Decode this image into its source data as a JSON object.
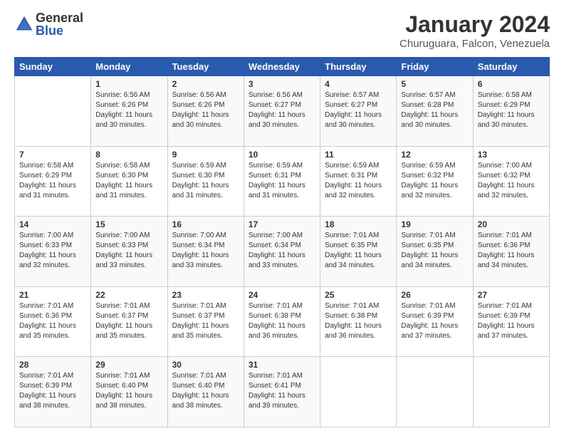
{
  "logo": {
    "general": "General",
    "blue": "Blue"
  },
  "title": "January 2024",
  "subtitle": "Churuguara, Falcon, Venezuela",
  "header_days": [
    "Sunday",
    "Monday",
    "Tuesday",
    "Wednesday",
    "Thursday",
    "Friday",
    "Saturday"
  ],
  "weeks": [
    [
      {
        "day": "",
        "sunrise": "",
        "sunset": "",
        "daylight": ""
      },
      {
        "day": "1",
        "sunrise": "Sunrise: 6:56 AM",
        "sunset": "Sunset: 6:26 PM",
        "daylight": "Daylight: 11 hours and 30 minutes."
      },
      {
        "day": "2",
        "sunrise": "Sunrise: 6:56 AM",
        "sunset": "Sunset: 6:26 PM",
        "daylight": "Daylight: 11 hours and 30 minutes."
      },
      {
        "day": "3",
        "sunrise": "Sunrise: 6:56 AM",
        "sunset": "Sunset: 6:27 PM",
        "daylight": "Daylight: 11 hours and 30 minutes."
      },
      {
        "day": "4",
        "sunrise": "Sunrise: 6:57 AM",
        "sunset": "Sunset: 6:27 PM",
        "daylight": "Daylight: 11 hours and 30 minutes."
      },
      {
        "day": "5",
        "sunrise": "Sunrise: 6:57 AM",
        "sunset": "Sunset: 6:28 PM",
        "daylight": "Daylight: 11 hours and 30 minutes."
      },
      {
        "day": "6",
        "sunrise": "Sunrise: 6:58 AM",
        "sunset": "Sunset: 6:29 PM",
        "daylight": "Daylight: 11 hours and 30 minutes."
      }
    ],
    [
      {
        "day": "7",
        "sunrise": "Sunrise: 6:58 AM",
        "sunset": "Sunset: 6:29 PM",
        "daylight": "Daylight: 11 hours and 31 minutes."
      },
      {
        "day": "8",
        "sunrise": "Sunrise: 6:58 AM",
        "sunset": "Sunset: 6:30 PM",
        "daylight": "Daylight: 11 hours and 31 minutes."
      },
      {
        "day": "9",
        "sunrise": "Sunrise: 6:59 AM",
        "sunset": "Sunset: 6:30 PM",
        "daylight": "Daylight: 11 hours and 31 minutes."
      },
      {
        "day": "10",
        "sunrise": "Sunrise: 6:59 AM",
        "sunset": "Sunset: 6:31 PM",
        "daylight": "Daylight: 11 hours and 31 minutes."
      },
      {
        "day": "11",
        "sunrise": "Sunrise: 6:59 AM",
        "sunset": "Sunset: 6:31 PM",
        "daylight": "Daylight: 11 hours and 32 minutes."
      },
      {
        "day": "12",
        "sunrise": "Sunrise: 6:59 AM",
        "sunset": "Sunset: 6:32 PM",
        "daylight": "Daylight: 11 hours and 32 minutes."
      },
      {
        "day": "13",
        "sunrise": "Sunrise: 7:00 AM",
        "sunset": "Sunset: 6:32 PM",
        "daylight": "Daylight: 11 hours and 32 minutes."
      }
    ],
    [
      {
        "day": "14",
        "sunrise": "Sunrise: 7:00 AM",
        "sunset": "Sunset: 6:33 PM",
        "daylight": "Daylight: 11 hours and 32 minutes."
      },
      {
        "day": "15",
        "sunrise": "Sunrise: 7:00 AM",
        "sunset": "Sunset: 6:33 PM",
        "daylight": "Daylight: 11 hours and 33 minutes."
      },
      {
        "day": "16",
        "sunrise": "Sunrise: 7:00 AM",
        "sunset": "Sunset: 6:34 PM",
        "daylight": "Daylight: 11 hours and 33 minutes."
      },
      {
        "day": "17",
        "sunrise": "Sunrise: 7:00 AM",
        "sunset": "Sunset: 6:34 PM",
        "daylight": "Daylight: 11 hours and 33 minutes."
      },
      {
        "day": "18",
        "sunrise": "Sunrise: 7:01 AM",
        "sunset": "Sunset: 6:35 PM",
        "daylight": "Daylight: 11 hours and 34 minutes."
      },
      {
        "day": "19",
        "sunrise": "Sunrise: 7:01 AM",
        "sunset": "Sunset: 6:35 PM",
        "daylight": "Daylight: 11 hours and 34 minutes."
      },
      {
        "day": "20",
        "sunrise": "Sunrise: 7:01 AM",
        "sunset": "Sunset: 6:36 PM",
        "daylight": "Daylight: 11 hours and 34 minutes."
      }
    ],
    [
      {
        "day": "21",
        "sunrise": "Sunrise: 7:01 AM",
        "sunset": "Sunset: 6:36 PM",
        "daylight": "Daylight: 11 hours and 35 minutes."
      },
      {
        "day": "22",
        "sunrise": "Sunrise: 7:01 AM",
        "sunset": "Sunset: 6:37 PM",
        "daylight": "Daylight: 11 hours and 35 minutes."
      },
      {
        "day": "23",
        "sunrise": "Sunrise: 7:01 AM",
        "sunset": "Sunset: 6:37 PM",
        "daylight": "Daylight: 11 hours and 35 minutes."
      },
      {
        "day": "24",
        "sunrise": "Sunrise: 7:01 AM",
        "sunset": "Sunset: 6:38 PM",
        "daylight": "Daylight: 11 hours and 36 minutes."
      },
      {
        "day": "25",
        "sunrise": "Sunrise: 7:01 AM",
        "sunset": "Sunset: 6:38 PM",
        "daylight": "Daylight: 11 hours and 36 minutes."
      },
      {
        "day": "26",
        "sunrise": "Sunrise: 7:01 AM",
        "sunset": "Sunset: 6:39 PM",
        "daylight": "Daylight: 11 hours and 37 minutes."
      },
      {
        "day": "27",
        "sunrise": "Sunrise: 7:01 AM",
        "sunset": "Sunset: 6:39 PM",
        "daylight": "Daylight: 11 hours and 37 minutes."
      }
    ],
    [
      {
        "day": "28",
        "sunrise": "Sunrise: 7:01 AM",
        "sunset": "Sunset: 6:39 PM",
        "daylight": "Daylight: 11 hours and 38 minutes."
      },
      {
        "day": "29",
        "sunrise": "Sunrise: 7:01 AM",
        "sunset": "Sunset: 6:40 PM",
        "daylight": "Daylight: 11 hours and 38 minutes."
      },
      {
        "day": "30",
        "sunrise": "Sunrise: 7:01 AM",
        "sunset": "Sunset: 6:40 PM",
        "daylight": "Daylight: 11 hours and 38 minutes."
      },
      {
        "day": "31",
        "sunrise": "Sunrise: 7:01 AM",
        "sunset": "Sunset: 6:41 PM",
        "daylight": "Daylight: 11 hours and 39 minutes."
      },
      {
        "day": "",
        "sunrise": "",
        "sunset": "",
        "daylight": ""
      },
      {
        "day": "",
        "sunrise": "",
        "sunset": "",
        "daylight": ""
      },
      {
        "day": "",
        "sunrise": "",
        "sunset": "",
        "daylight": ""
      }
    ]
  ]
}
